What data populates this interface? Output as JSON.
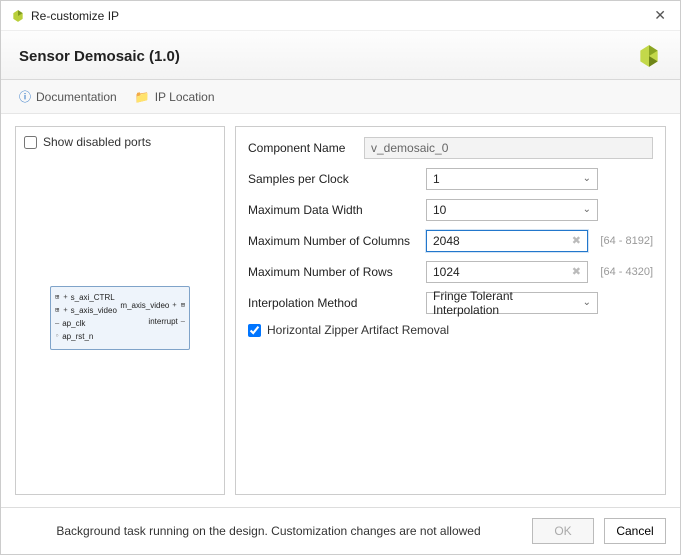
{
  "titlebar": {
    "title": "Re-customize IP"
  },
  "header": {
    "ip_title": "Sensor Demosaic (1.0)"
  },
  "links": {
    "documentation": "Documentation",
    "ip_location": "IP Location"
  },
  "left": {
    "show_disabled_ports": "Show disabled ports",
    "ports": {
      "s_axi_ctrl": "s_axi_CTRL",
      "s_axis_video": "s_axis_video",
      "ap_clk": "ap_clk",
      "ap_rst_n": "ap_rst_n",
      "m_axis_video": "m_axis_video",
      "interrupt": "interrupt"
    }
  },
  "form": {
    "component_name_label": "Component Name",
    "component_name_value": "v_demosaic_0",
    "samples_per_clock_label": "Samples per Clock",
    "samples_per_clock_value": "1",
    "max_data_width_label": "Maximum Data Width",
    "max_data_width_value": "10",
    "max_cols_label": "Maximum Number of Columns",
    "max_cols_value": "2048",
    "max_cols_range": "[64 - 8192]",
    "max_rows_label": "Maximum Number of Rows",
    "max_rows_value": "1024",
    "max_rows_range": "[64 - 4320]",
    "interp_label": "Interpolation Method",
    "interp_value": "Fringe Tolerant Interpolation",
    "zipper_label": "Horizontal Zipper Artifact Removal",
    "zipper_checked": true
  },
  "footer": {
    "message": "Background task running on the design. Customization changes are not allowed",
    "ok": "OK",
    "cancel": "Cancel"
  }
}
